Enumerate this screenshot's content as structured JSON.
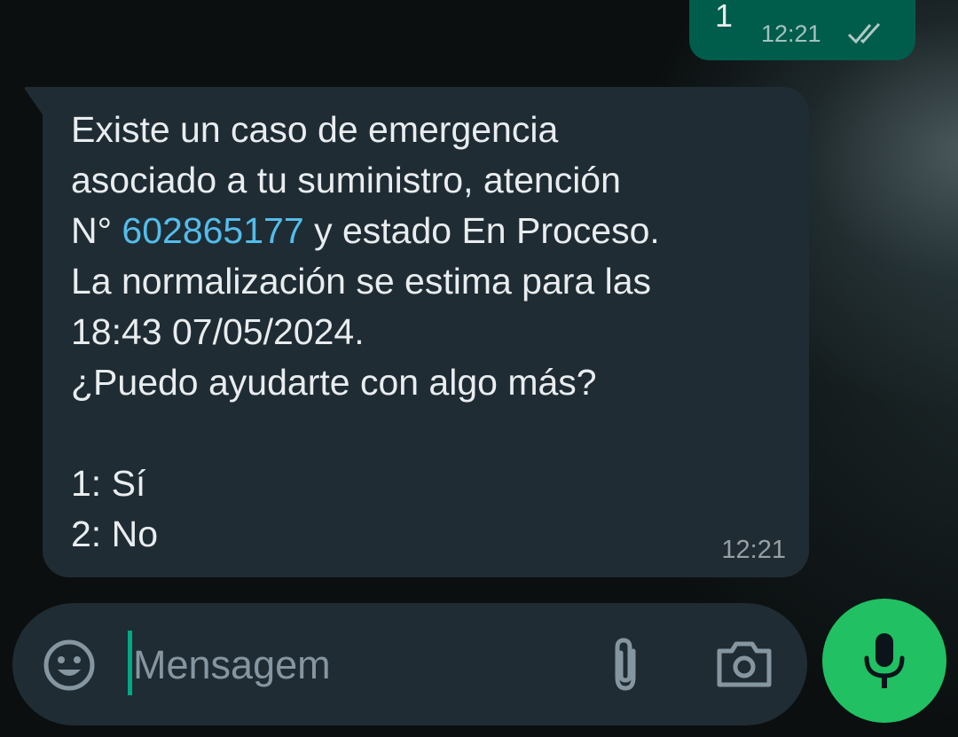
{
  "sent_message": {
    "text": "1",
    "time": "12:21",
    "status_icon": "double-check-read-icon"
  },
  "received_message": {
    "lines": [
      "Existe un caso de emergencia",
      "asociado a tu suministro, atención",
      "y estado En Proceso.",
      "La normalización se estima para las",
      "18:43 07/05/2024.",
      "¿Puedo ayudarte con algo más?",
      "",
      "1: Sí",
      "2: No"
    ],
    "number_prefix": "N°",
    "case_number": "602865177",
    "time": "12:21"
  },
  "composer": {
    "placeholder": "Mensagem",
    "emoji_icon": "emoji-icon",
    "attach_icon": "paperclip-icon",
    "camera_icon": "camera-icon",
    "mic_icon": "microphone-icon"
  },
  "colors": {
    "sent_bubble": "#005c4b",
    "received_bubble": "#1f2c34",
    "link": "#53bdeb",
    "accent": "#21c063",
    "caret": "#00a884"
  }
}
